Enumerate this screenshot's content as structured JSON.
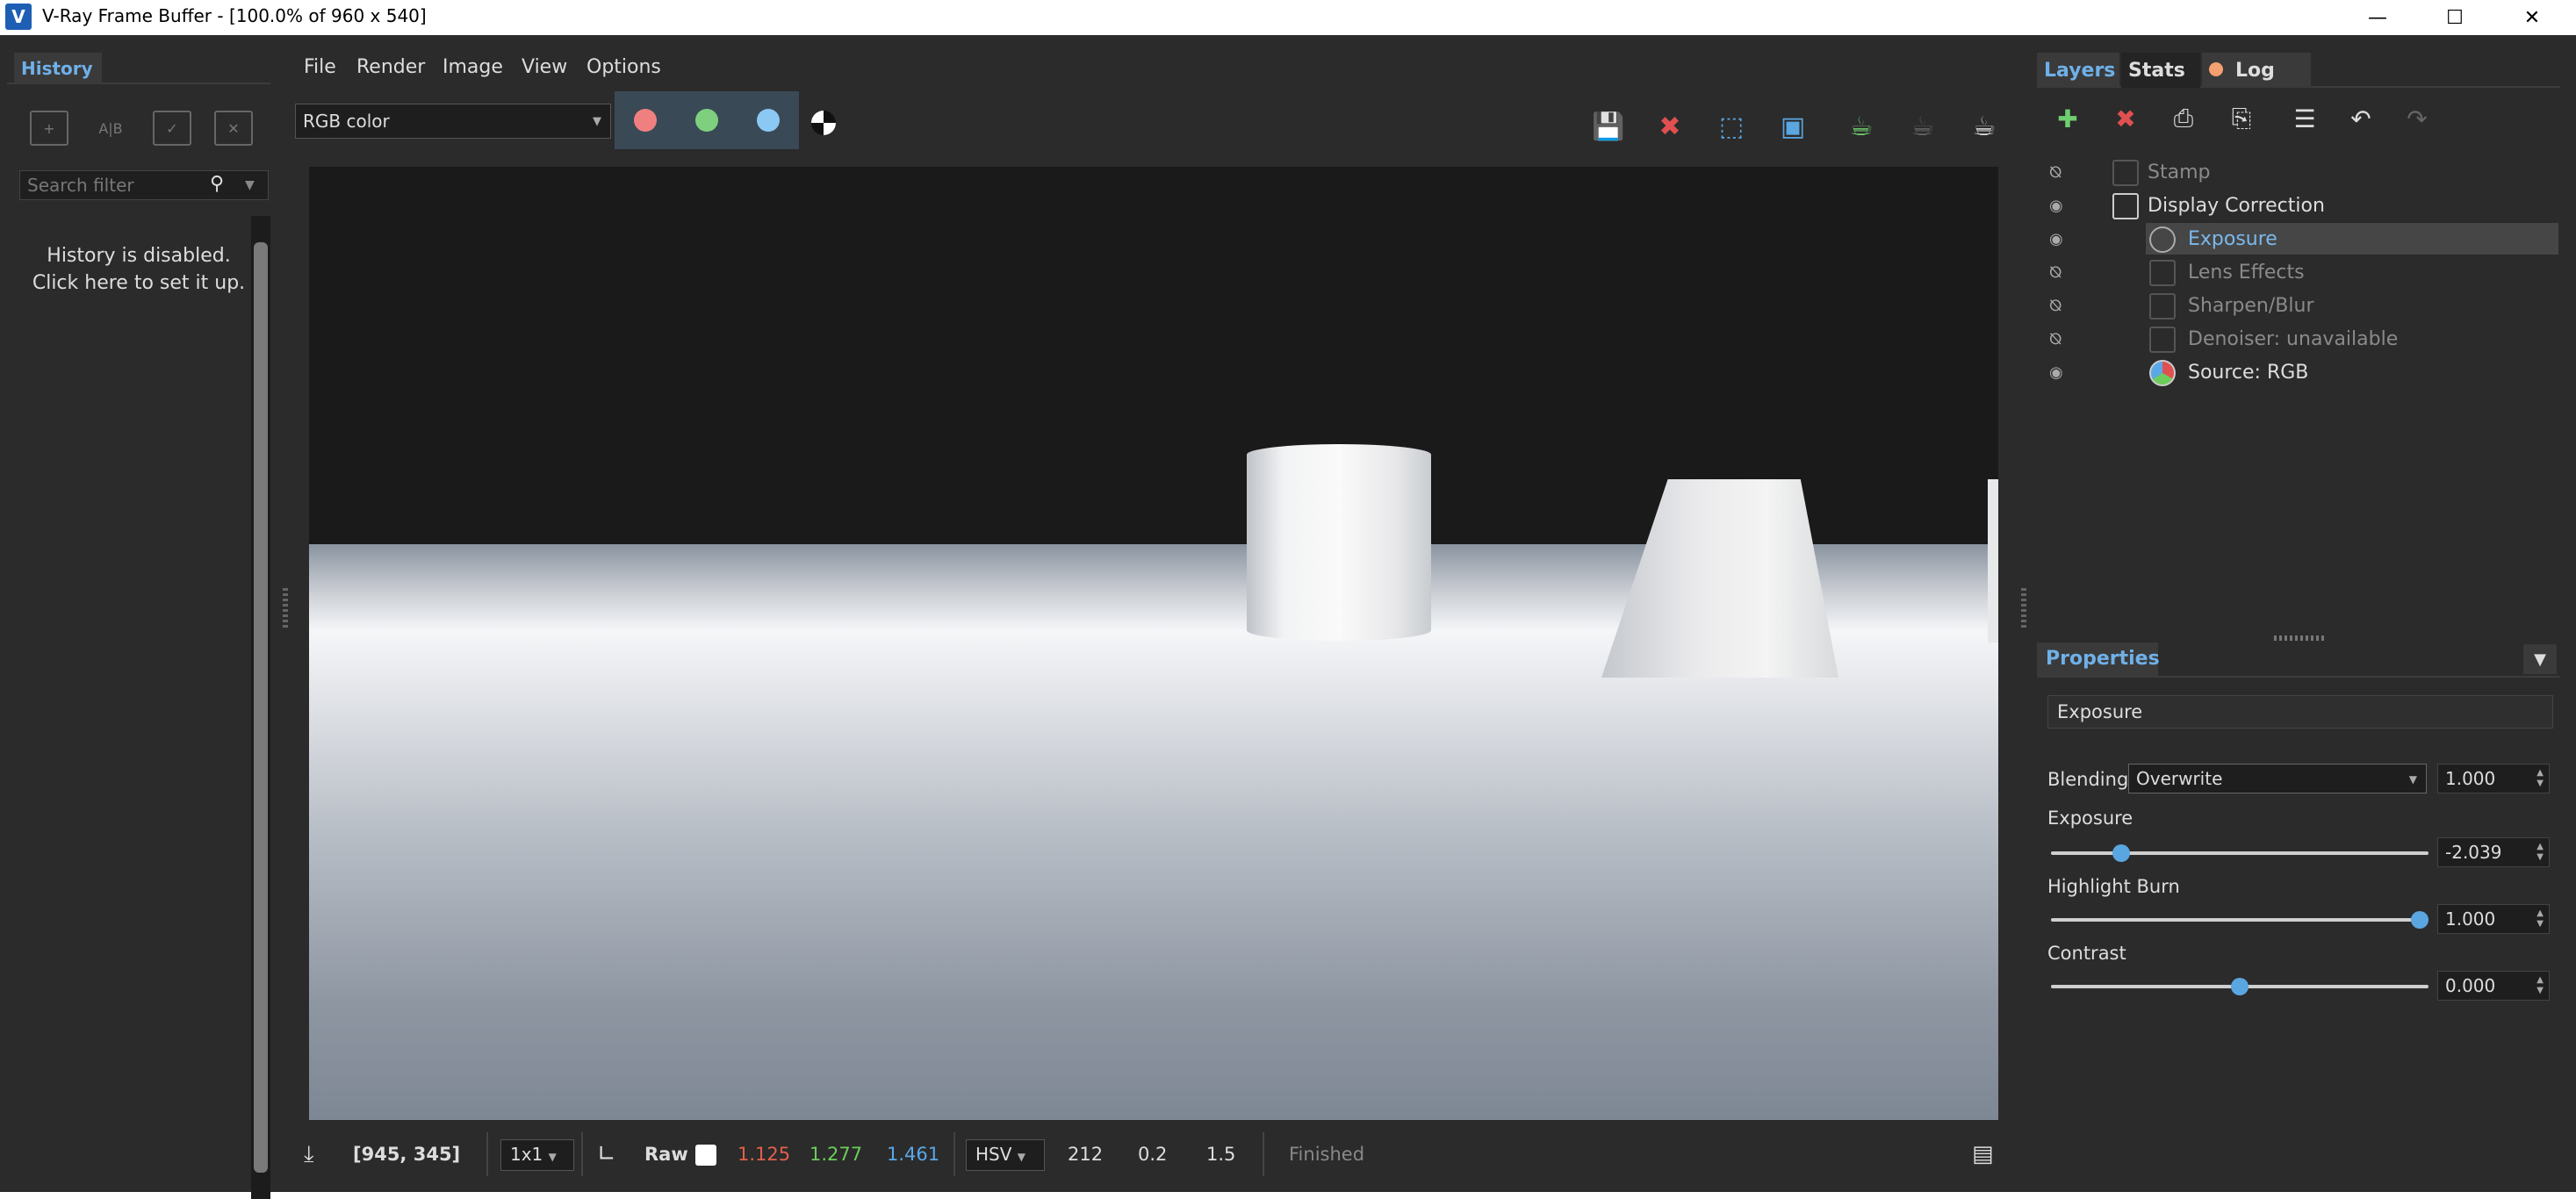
{
  "window": {
    "title": "V-Ray Frame Buffer - [100.0% of 960 x 540]",
    "app_icon": "V",
    "minimize": "—",
    "maximize": "☐",
    "close": "✕"
  },
  "history": {
    "tab": "History",
    "search_placeholder": "Search filter",
    "message_line1": "History is disabled.",
    "message_line2": "Click here to set it up.",
    "ab_label": "A|B"
  },
  "menu": {
    "file": "File",
    "render": "Render",
    "image": "Image",
    "view": "View",
    "options": "Options"
  },
  "toolbar": {
    "channel": "RGB color",
    "channel_colors": {
      "red": "#f08080",
      "green": "#7ed07e",
      "blue": "#8cc8f4"
    }
  },
  "status": {
    "coords": "[945, 345]",
    "zoom_select": "1x1",
    "raw_label": "Raw",
    "r": "1.125",
    "g": "1.277",
    "b": "1.461",
    "color_space": "HSV",
    "h": "212",
    "s": "0.2",
    "v": "1.5",
    "state": "Finished",
    "colors": {
      "r": "#e0604c",
      "g": "#6ccc5c",
      "b": "#5aa8e8"
    }
  },
  "layers": {
    "tabs": {
      "layers": "Layers",
      "stats": "Stats",
      "log": "Log"
    },
    "items": [
      {
        "label": "Stamp",
        "enabled": false
      },
      {
        "label": "Display Correction",
        "enabled": true
      },
      {
        "label": "Exposure",
        "enabled": true,
        "selected": true
      },
      {
        "label": "Lens Effects",
        "enabled": false
      },
      {
        "label": "Sharpen/Blur",
        "enabled": false
      },
      {
        "label": "Denoiser: unavailable",
        "enabled": false
      },
      {
        "label": "Source: RGB",
        "enabled": true
      }
    ]
  },
  "properties": {
    "tab": "Properties",
    "name": "Exposure",
    "blending_label": "Blending",
    "blending_mode": "Overwrite",
    "blending_amount": "1.000",
    "exposure_label": "Exposure",
    "exposure_value": "-2.039",
    "exposure_level": 0.17,
    "highlight_label": "Highlight Burn",
    "highlight_value": "1.000",
    "highlight_level": 1.0,
    "contrast_label": "Contrast",
    "contrast_value": "0.000",
    "contrast_level": 0.5
  }
}
